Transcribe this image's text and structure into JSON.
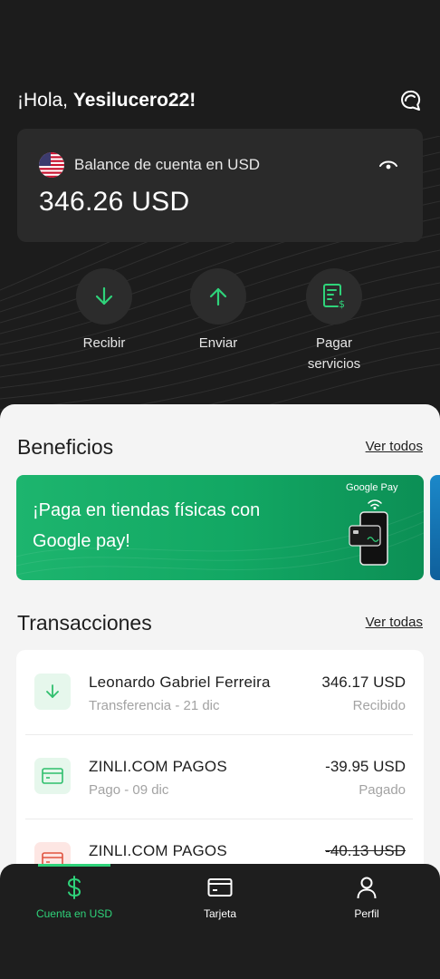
{
  "header": {
    "greeting_prefix": "¡Hola, ",
    "username": "Yesilucero22!",
    "support_icon": "chat-support-icon"
  },
  "balance": {
    "label": "Balance de cuenta en USD",
    "amount": "346.26  USD",
    "flag_icon": "us-flag-icon",
    "visibility_icon": "eye-icon"
  },
  "actions": [
    {
      "label": "Recibir",
      "icon": "arrow-down-icon"
    },
    {
      "label": "Enviar",
      "icon": "arrow-up-icon"
    },
    {
      "label": "Pagar\nservicios",
      "icon": "bill-payment-icon"
    }
  ],
  "benefits": {
    "title": "Beneficios",
    "link": "Ver todos",
    "promo_text": "¡Paga en tiendas físicas con Google pay!",
    "promo_brand": "Google Pay"
  },
  "transactions": {
    "title": "Transacciones",
    "link": "Ver todas",
    "items": [
      {
        "name": "Leonardo Gabriel Ferreira",
        "sub": "Transferencia - 21 dic",
        "amount": "346.17 USD",
        "status": "Recibido",
        "icon": "arrow-down-icon"
      },
      {
        "name": "ZINLI.COM  PAGOS",
        "sub": "Pago - 09 dic",
        "amount": "-39.95 USD",
        "status": "Pagado",
        "icon": "card-icon"
      },
      {
        "name": "ZINLI.COM  PAGOS",
        "sub": "",
        "amount": "-40.13 USD",
        "status": "",
        "icon": "card-icon"
      }
    ]
  },
  "nav": {
    "items": [
      {
        "label": "Cuenta en USD",
        "icon": "dollar-icon",
        "active": true
      },
      {
        "label": "Tarjeta",
        "icon": "card-icon",
        "active": false
      },
      {
        "label": "Perfil",
        "icon": "user-icon",
        "active": false
      }
    ]
  },
  "colors": {
    "accent": "#2fd37a",
    "background_dark": "#1c1c1c",
    "sheet": "#f4f4f4",
    "promo_green": "#12a763"
  }
}
